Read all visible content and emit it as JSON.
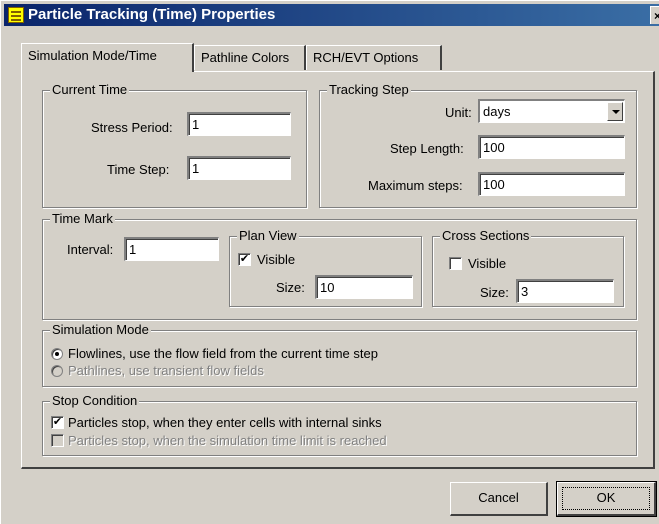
{
  "window": {
    "title": "Particle Tracking (Time) Properties",
    "close_glyph": "×",
    "icon": "properties-icon"
  },
  "tabs": [
    {
      "label": "Simulation Mode/Time",
      "active": true
    },
    {
      "label": "Pathline Colors",
      "active": false
    },
    {
      "label": "RCH/EVT Options",
      "active": false
    }
  ],
  "current_time": {
    "title": "Current Time",
    "stress_period_label": "Stress Period:",
    "stress_period_value": "1",
    "time_step_label": "Time Step:",
    "time_step_value": "1"
  },
  "tracking_step": {
    "title": "Tracking Step",
    "unit_label": "Unit:",
    "unit_value": "days",
    "step_length_label": "Step Length:",
    "step_length_value": "100",
    "max_steps_label": "Maximum steps:",
    "max_steps_value": "100"
  },
  "time_mark": {
    "title": "Time Mark",
    "interval_label": "Interval:",
    "interval_value": "1",
    "plan_view": {
      "title": "Plan View",
      "visible_label": "Visible",
      "visible_checked": true,
      "size_label": "Size:",
      "size_value": "10"
    },
    "cross_sections": {
      "title": "Cross Sections",
      "visible_label": "Visible",
      "visible_checked": false,
      "size_label": "Size:",
      "size_value": "3"
    }
  },
  "simulation_mode": {
    "title": "Simulation Mode",
    "options": [
      {
        "label": "Flowlines, use the flow field from the current time step",
        "selected": true,
        "enabled": true
      },
      {
        "label": "Pathlines, use transient flow fields",
        "selected": false,
        "enabled": false
      }
    ]
  },
  "stop_condition": {
    "title": "Stop Condition",
    "options": [
      {
        "label": "Particles stop, when they enter cells with internal sinks",
        "checked": true,
        "enabled": true
      },
      {
        "label": "Particles stop, when the simulation time limit is reached",
        "checked": false,
        "enabled": false
      }
    ]
  },
  "buttons": {
    "cancel_label": "Cancel",
    "ok_label": "OK"
  },
  "colors": {
    "titlebar_start": "#0a246a",
    "titlebar_end": "#3a6ea5",
    "face": "#d4d0c8"
  },
  "check_glyph": "✔"
}
